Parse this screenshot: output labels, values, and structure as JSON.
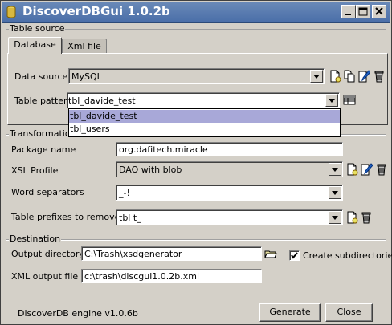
{
  "window": {
    "title": "DiscoverDBGui 1.0.2b"
  },
  "table_source": {
    "group_label": "Table source",
    "tabs": [
      {
        "label": "Database"
      },
      {
        "label": "Xml file"
      }
    ],
    "data_source": {
      "label": "Data source",
      "value": "MySQL"
    },
    "table_pattern": {
      "label": "Table pattern",
      "value": "tbl_davide_test",
      "options": [
        "tbl_davide_test",
        "tbl_users"
      ]
    }
  },
  "transformation": {
    "group_label": "Transformation",
    "package_name": {
      "label": "Package name",
      "value": "org.dafitech.miracle"
    },
    "xsl_profile": {
      "label": "XSL Profile",
      "value": "DAO with blob"
    },
    "word_separators": {
      "label": "Word separators",
      "value": "_-!"
    },
    "table_prefixes": {
      "label": "Table prefixes to remove",
      "value": "tbl t_"
    }
  },
  "destination": {
    "group_label": "Destination",
    "output_directory": {
      "label": "Output directory",
      "value": "C:\\Trash\\xsdgenerator"
    },
    "create_subdirs": {
      "label": "Create subdirectories",
      "checked": true
    },
    "xml_output_file": {
      "label": "XML output file",
      "value": "c:\\trash\\discgui1.0.2b.xml"
    }
  },
  "footer": {
    "engine_version": "DiscoverDB engine v1.0.6b",
    "generate_label": "Generate",
    "close_label": "Close"
  }
}
